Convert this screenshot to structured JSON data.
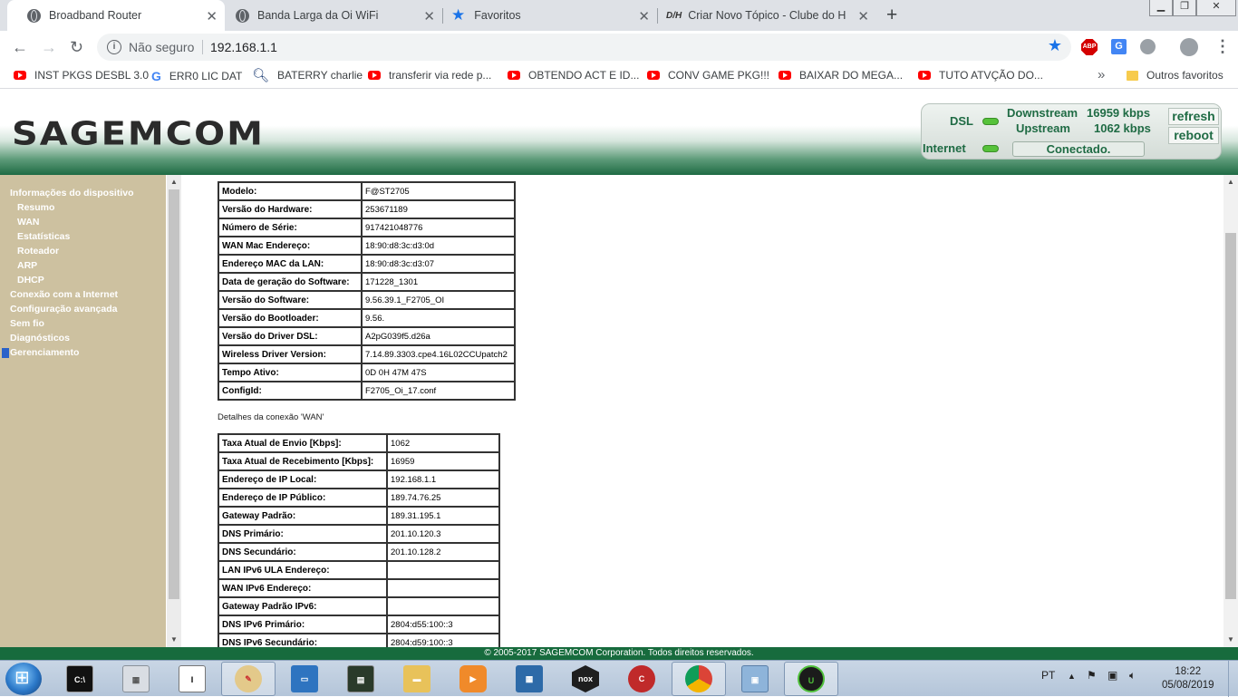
{
  "browser": {
    "tabs": [
      {
        "title": "Broadband Router",
        "icon": "globe-icon"
      },
      {
        "title": "Banda Larga da Oi WiFi",
        "icon": "globe-icon"
      },
      {
        "title": "Favoritos",
        "icon": "star-icon"
      },
      {
        "title": "Criar Novo Tópico - Clube do Ha",
        "icon": "dh-icon"
      }
    ],
    "security_label": "Não seguro",
    "url": "192.168.1.1",
    "bookmarks": [
      {
        "label": "INST PKGS DESBL 3.0",
        "icon": "youtube-icon"
      },
      {
        "label": "ERR0 LIC DAT",
        "icon": "google-icon"
      },
      {
        "label": "BATERRY charlie",
        "icon": "magnifier-icon"
      },
      {
        "label": "transferir via rede p...",
        "icon": "youtube-icon"
      },
      {
        "label": "OBTENDO ACT E ID...",
        "icon": "youtube-icon"
      },
      {
        "label": "CONV GAME PKG!!!",
        "icon": "youtube-icon"
      },
      {
        "label": "BAIXAR DO MEGA...",
        "icon": "youtube-icon"
      },
      {
        "label": "TUTO ATVÇÃO DO...",
        "icon": "youtube-icon"
      }
    ],
    "more_bookmarks": "»",
    "other_bookmarks": "Outros favoritos",
    "ext_abp": "ABP",
    "ext_translate": "G"
  },
  "router": {
    "logo": "SAGEMCOM",
    "status": {
      "dsl_label": "DSL",
      "internet_label": "Internet",
      "downstream_label": "Downstream",
      "downstream_value": "16959 kbps",
      "upstream_label": "Upstream",
      "upstream_value": "1062 kbps",
      "connection": "Conectado.",
      "refresh": "refresh",
      "reboot": "reboot"
    },
    "menu": [
      {
        "label": "Informações do dispositivo",
        "level": 0
      },
      {
        "label": "Resumo",
        "level": 1
      },
      {
        "label": "WAN",
        "level": 1
      },
      {
        "label": "Estatísticas",
        "level": 1
      },
      {
        "label": "Roteador",
        "level": 1
      },
      {
        "label": "ARP",
        "level": 1
      },
      {
        "label": "DHCP",
        "level": 1
      },
      {
        "label": "Conexão com a Internet",
        "level": 0
      },
      {
        "label": "Configuração avançada",
        "level": 0
      },
      {
        "label": "Sem fio",
        "level": 0
      },
      {
        "label": "Diagnósticos",
        "level": 0
      },
      {
        "label": "Gerenciamento",
        "level": 0
      }
    ],
    "device_info": [
      [
        "Modelo:",
        "F@ST2705"
      ],
      [
        "Versão do Hardware:",
        "253671189"
      ],
      [
        "Número de Série:",
        "917421048776"
      ],
      [
        "WAN Mac Endereço:",
        "18:90:d8:3c:d3:0d"
      ],
      [
        "Endereço MAC da LAN:",
        "18:90:d8:3c:d3:07"
      ],
      [
        "Data de geração do Software:",
        "171228_1301"
      ],
      [
        "Versão do Software:",
        "9.56.39.1_F2705_OI"
      ],
      [
        "Versão do Bootloader:",
        "9.56."
      ],
      [
        "Versão do Driver DSL:",
        "A2pG039f5.d26a"
      ],
      [
        "Wireless Driver Version:",
        "7.14.89.3303.cpe4.16L02CCUpatch2"
      ],
      [
        "Tempo Ativo:",
        "0D 0H 47M 47S"
      ],
      [
        "ConfigId:",
        "F2705_Oi_17.conf"
      ]
    ],
    "wan_caption": "Detalhes da conexão 'WAN'",
    "wan_info": [
      [
        "Taxa Atual de Envio [Kbps]:",
        "1062"
      ],
      [
        "Taxa Atual de Recebimento [Kbps]:",
        "16959"
      ],
      [
        "Endereço de IP Local:",
        "192.168.1.1"
      ],
      [
        "Endereço de IP Público:",
        "189.74.76.25"
      ],
      [
        "Gateway Padrão:",
        "189.31.195.1"
      ],
      [
        "DNS Primário:",
        "201.10.120.3"
      ],
      [
        "DNS Secundário:",
        "201.10.128.2"
      ],
      [
        "LAN IPv6 ULA Endereço:",
        ""
      ],
      [
        "WAN IPv6 Endereço:",
        ""
      ],
      [
        "Gateway Padrão IPv6:",
        ""
      ],
      [
        "DNS IPv6 Primário:",
        "2804:d55:100::3"
      ],
      [
        "DNS IPv6 Secundário:",
        "2804:d59:100::3"
      ]
    ],
    "footer": "© 2005-2017 SAGEMCOM Corporation. Todos direitos reservados."
  },
  "taskbar": {
    "language": "PT",
    "time": "18:22",
    "date": "05/08/2019"
  }
}
